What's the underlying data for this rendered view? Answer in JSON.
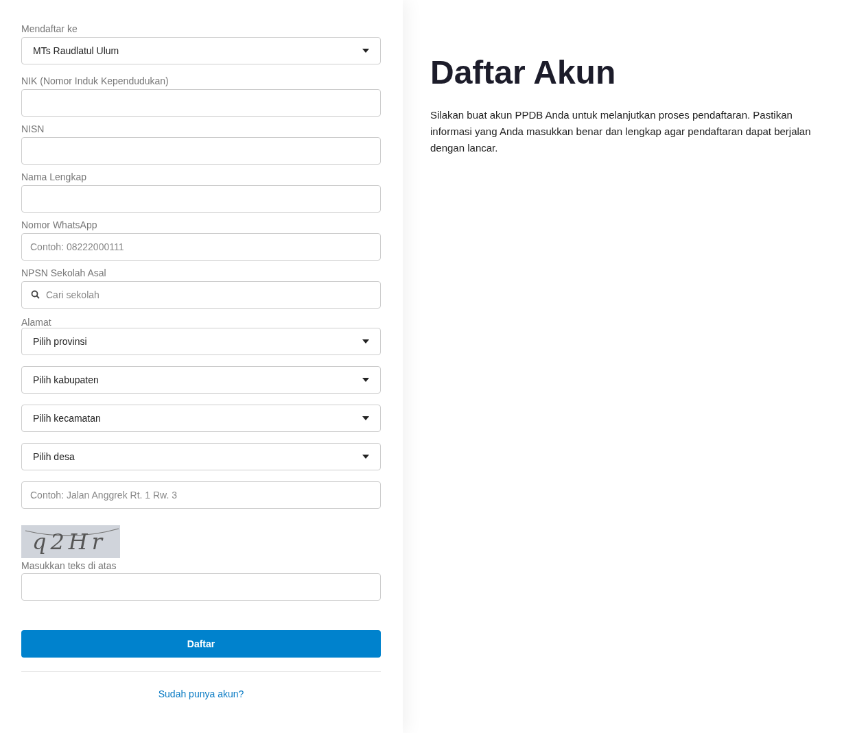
{
  "form": {
    "fields": [
      {
        "kind": "select",
        "label": "Mendaftar ke",
        "value": "MTs Raudlatul Ulum"
      },
      {
        "kind": "text",
        "label": "NIK (Nomor Induk Kependudukan)"
      },
      {
        "kind": "text",
        "label": "NISN"
      },
      {
        "kind": "text",
        "label": "Nama Lengkap"
      },
      {
        "kind": "text",
        "label": "Nomor WhatsApp",
        "placeholder": "Contoh: 08222000111"
      },
      {
        "kind": "search",
        "label": "NPSN Sekolah Asal",
        "placeholder": "Cari sekolah"
      }
    ],
    "address": {
      "label": "Alamat",
      "selects": [
        "Pilih provinsi",
        "Pilih kabupaten",
        "Pilih kecamatan",
        "Pilih desa"
      ],
      "placeholder": "Contoh: Jalan Anggrek Rt. 1 Rw. 3"
    },
    "captcha": {
      "code": "q2Hr",
      "label": "Masukkan teks di atas"
    },
    "submit": "Daftar",
    "login_link": "Sudah punya akun?"
  },
  "intro": {
    "title": "Daftar Akun",
    "description": "Silakan buat akun PPDB Anda untuk melanjutkan proses pendaftaran. Pastikan informasi yang Anda masukkan benar dan lengkap agar pendaftaran dapat berjalan dengan lancar."
  }
}
